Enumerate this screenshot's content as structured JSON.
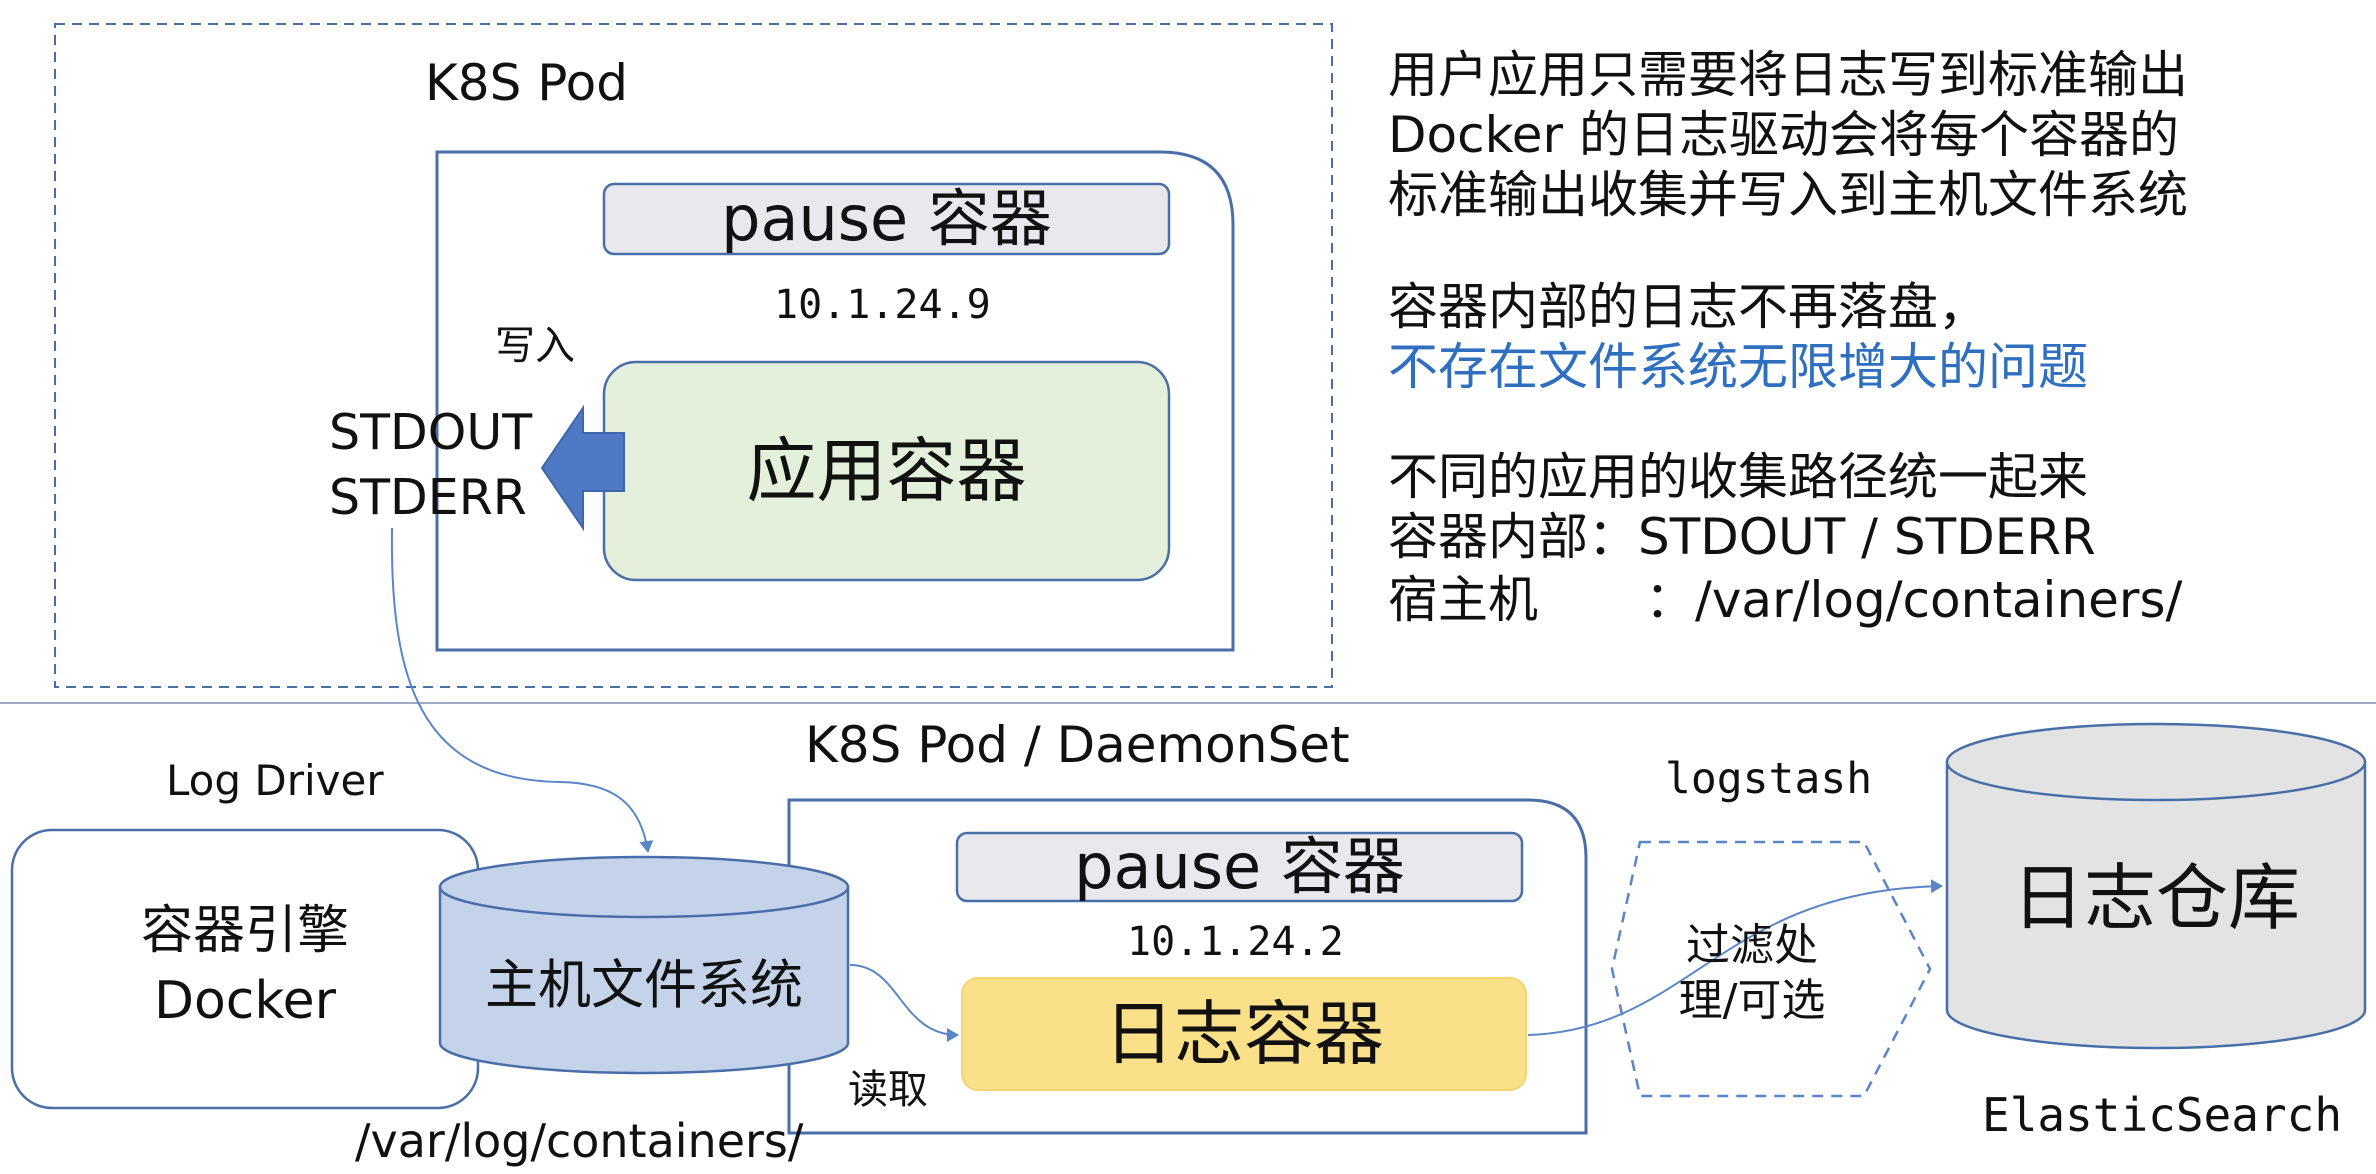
{
  "top_pod": {
    "title": "K8S Pod",
    "pause_container": "pause 容器",
    "pod_ip": "10.1.24.9",
    "write_label": "写入",
    "stdout": "STDOUT",
    "stderr": "STDERR",
    "app_container": "应用容器"
  },
  "notes": {
    "block1": [
      "用户应用只需要将日志写到标准输出",
      "Docker 的日志驱动会将每个容器的",
      "标准输出收集并写入到主机文件系统"
    ],
    "block2_line1": "容器内部的日志不再落盘，",
    "block2_line2": "不存在文件系统无限增大的问题",
    "block3_line1": "不同的应用的收集路径统一起来",
    "block3_line2": "容器内部：STDOUT / STDERR",
    "block3_line3_label": "宿主机",
    "block3_line3_value": "：/var/log/containers/"
  },
  "bottom": {
    "log_driver": "Log Driver",
    "engine_line1": "容器引擎",
    "engine_line2": "Docker",
    "host_fs": "主机文件系统",
    "host_path": "/var/log/containers/",
    "daemonset_title": "K8S Pod / DaemonSet",
    "pause_container": "pause 容器",
    "pod_ip": "10.1.24.2",
    "read_label": "读取",
    "log_container": "日志容器",
    "logstash": "logstash",
    "filter_line1": "过滤处",
    "filter_line2": "理/可选",
    "log_store": "日志仓库",
    "elasticsearch": "ElasticSearch"
  },
  "colors": {
    "stroke_blue": "#4a6ea8",
    "arrow_blue": "#4f79c4",
    "app_fill": "#e4efdc",
    "pause_fill": "#e9e9ed",
    "log_container_fill": "#fbe08a",
    "host_fs_fill": "#c5d3ea",
    "store_fill": "#e3e3e3",
    "highlight_text": "#2f6fbf"
  }
}
